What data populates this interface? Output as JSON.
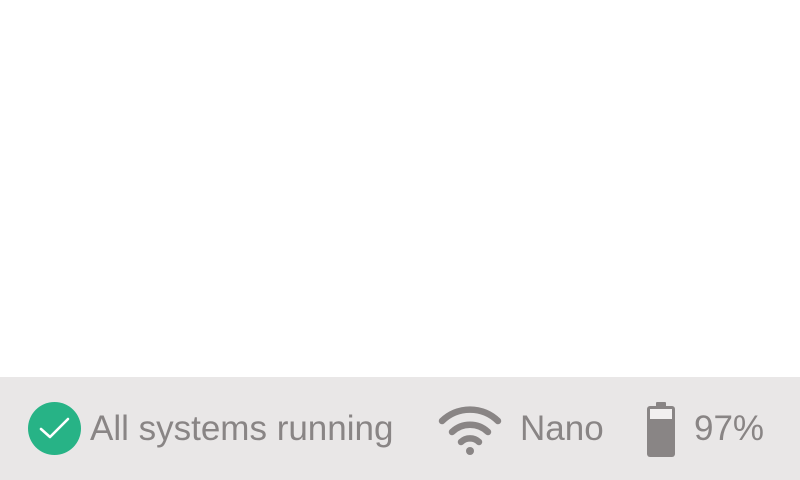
{
  "status_bar": {
    "system_status": {
      "label": "All systems running",
      "icon": "check-circle-icon",
      "color": "#27b386"
    },
    "wifi": {
      "network_name": "Nano",
      "icon": "wifi-icon"
    },
    "battery": {
      "level_text": "97%",
      "level": 0.97,
      "icon": "battery-icon"
    }
  }
}
